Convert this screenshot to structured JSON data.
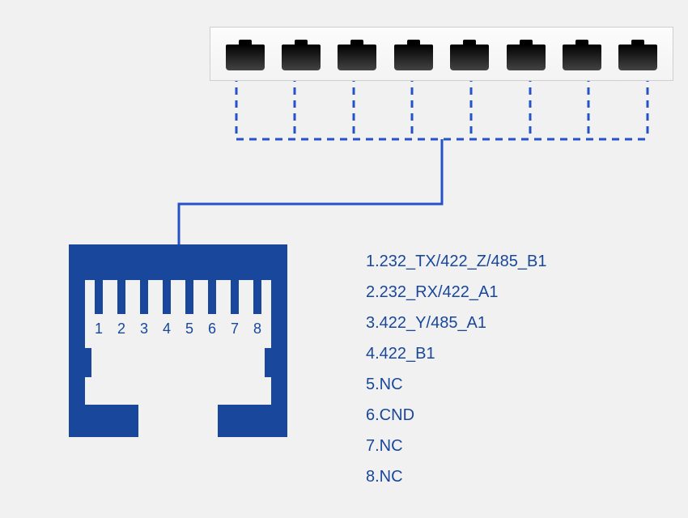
{
  "chart_data": {
    "type": "table",
    "title": "RJ45 port pinout",
    "pin_labels": [
      "1",
      "2",
      "3",
      "4",
      "5",
      "6",
      "7",
      "8"
    ],
    "pins": [
      {
        "pin": 1,
        "signal": "232_TX/422_Z/485_B1"
      },
      {
        "pin": 2,
        "signal": "232_RX/422_A1"
      },
      {
        "pin": 3,
        "signal": "422_Y/485_A1"
      },
      {
        "pin": 4,
        "signal": "422_B1"
      },
      {
        "pin": 5,
        "signal": "NC"
      },
      {
        "pin": 6,
        "signal": "CND"
      },
      {
        "pin": 7,
        "signal": "NC"
      },
      {
        "pin": 8,
        "signal": "NC"
      }
    ],
    "legend_lines": [
      "1.232_TX/422_Z/485_B1",
      "2.232_RX/422_A1",
      "3.422_Y/485_A1",
      "4.422_B1",
      "5.NC",
      "6.CND",
      "7.NC",
      "8.NC"
    ]
  },
  "colors": {
    "accent": "#18479b",
    "background": "#f1f1f1"
  },
  "top_ports": 8
}
